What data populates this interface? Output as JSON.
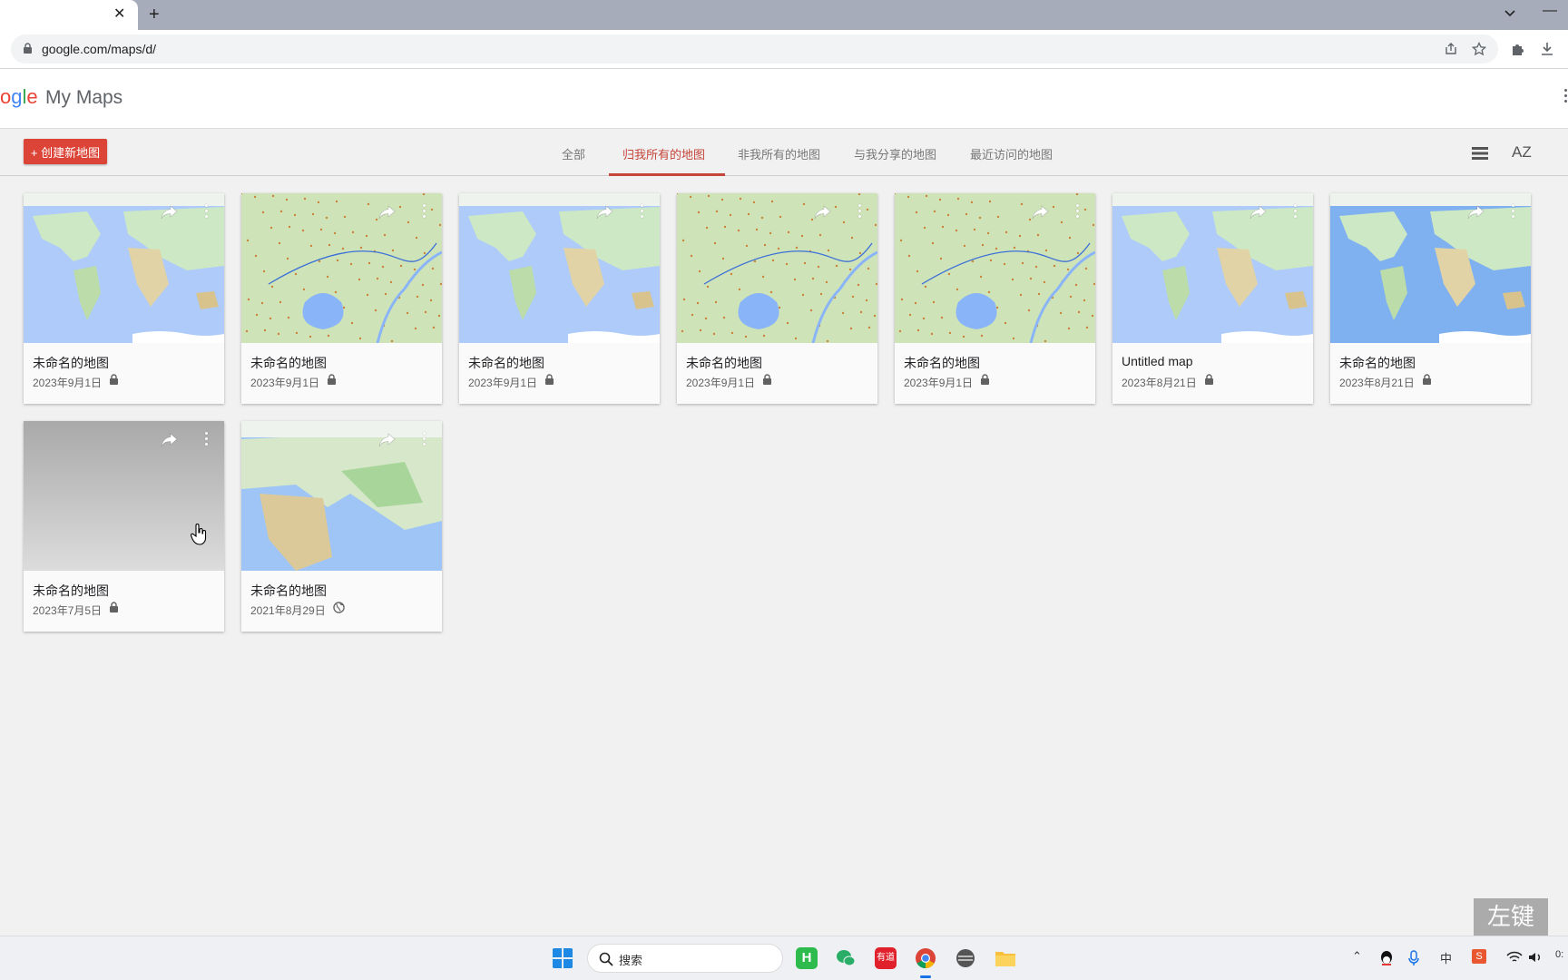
{
  "browser": {
    "url": "google.com/maps/d/"
  },
  "app": {
    "logo_text": "ogle",
    "product_name": "My Maps"
  },
  "actions": {
    "create_label": "+ 创建新地图"
  },
  "filter_tabs": [
    {
      "label": "全部",
      "active": false
    },
    {
      "label": "归我所有的地图",
      "active": true
    },
    {
      "label": "非我所有的地图",
      "active": false
    },
    {
      "label": "与我分享的地图",
      "active": false
    },
    {
      "label": "最近访问的地图",
      "active": false
    }
  ],
  "sort_label": "AZ",
  "maps": [
    {
      "title": "未命名的地图",
      "date": "2023年9月1日",
      "visibility": "private",
      "thumbnail": "world"
    },
    {
      "title": "未命名的地图",
      "date": "2023年9月1日",
      "visibility": "private",
      "thumbnail": "china-route"
    },
    {
      "title": "未命名的地图",
      "date": "2023年9月1日",
      "visibility": "private",
      "thumbnail": "world"
    },
    {
      "title": "未命名的地图",
      "date": "2023年9月1日",
      "visibility": "private",
      "thumbnail": "china-route"
    },
    {
      "title": "未命名的地图",
      "date": "2023年9月1日",
      "visibility": "private",
      "thumbnail": "china-route"
    },
    {
      "title": "Untitled map",
      "date": "2023年8月21日",
      "visibility": "private",
      "thumbnail": "world"
    },
    {
      "title": "未命名的地图",
      "date": "2023年8月21日",
      "visibility": "private",
      "thumbnail": "world-blue"
    },
    {
      "title": "未命名的地图",
      "date": "2023年7月5日",
      "visibility": "private",
      "thumbnail": "blank"
    },
    {
      "title": "未命名的地图",
      "date": "2021年8月29日",
      "visibility": "public",
      "thumbnail": "eurasia"
    }
  ],
  "taskbar": {
    "search_placeholder": "搜索",
    "ime_label": "中",
    "clock_partial": "0:"
  },
  "watermark": "左键",
  "colors": {
    "accent_red": "#db4437",
    "active_tab": "#c5453a",
    "ocean": "#aecbfa",
    "land": "#cde8c4"
  }
}
